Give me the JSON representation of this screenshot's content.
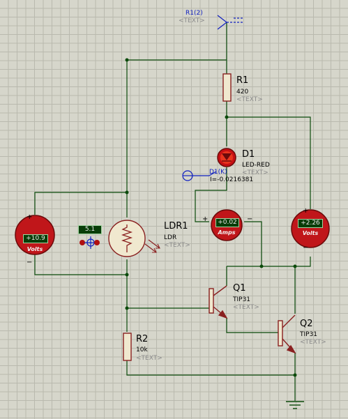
{
  "terminal": {
    "name": "R1(2)",
    "text": "<TEXT>"
  },
  "r1": {
    "name": "R1",
    "value": "420",
    "text": "<TEXT>"
  },
  "d1": {
    "name": "D1",
    "type": "LED-RED",
    "text": "<TEXT>",
    "probe_name": "D1(K)",
    "probe_value": "I=-0.0216381"
  },
  "ldr1": {
    "name": "LDR1",
    "type": "LDR",
    "text": "<TEXT>",
    "light_level": "5.1"
  },
  "r2": {
    "name": "R2",
    "value": "10k",
    "text": "<TEXT>"
  },
  "q1": {
    "name": "Q1",
    "type": "TIP31",
    "text": "<TEXT>"
  },
  "q2": {
    "name": "Q2",
    "type": "TIP31",
    "text": "<TEXT>"
  },
  "voltmeter_left": {
    "value": "+10.9",
    "unit": "Volts",
    "plus": "+",
    "minus": "−"
  },
  "ammeter": {
    "value": "+0.02",
    "unit": "Amps",
    "plus": "+",
    "minus": "−"
  },
  "voltmeter_right": {
    "value": "+2.26",
    "unit": "Volts",
    "plus": "+",
    "minus": "−"
  },
  "colors": {
    "wire": "#0b4a0b",
    "component": "#8a2020",
    "meter_body": "#c0161a",
    "display": "#083d08",
    "label_blue": "#1020c0"
  }
}
